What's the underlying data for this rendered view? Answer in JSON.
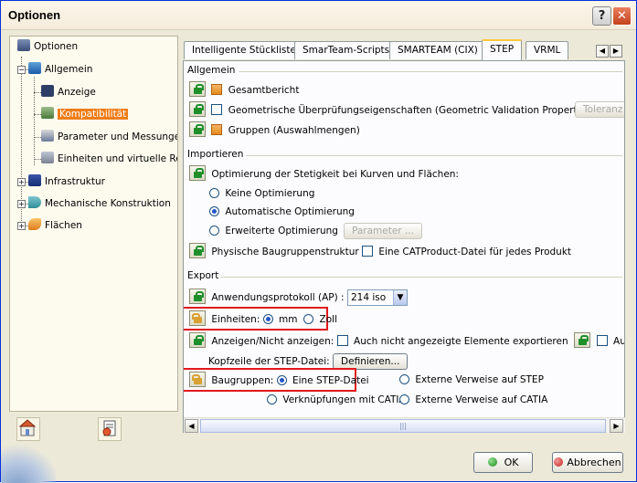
{
  "window": {
    "title": "Optionen",
    "help_glyph": "?",
    "close_glyph": "✕"
  },
  "tree": {
    "items": [
      {
        "label": "Optionen",
        "icon": "options-tree-icon"
      },
      {
        "label": "Allgemein",
        "icon": "general-icon"
      },
      {
        "label": "Anzeige",
        "icon": "display-icon"
      },
      {
        "label": "Kompatibilität",
        "icon": "compatibility-icon",
        "selected": true
      },
      {
        "label": "Parameter und Messungen",
        "icon": "parameters-icon"
      },
      {
        "label": "Einheiten und virtuelle Realit",
        "icon": "units-icon"
      },
      {
        "label": "Infrastruktur",
        "icon": "infrastructure-icon"
      },
      {
        "label": "Mechanische Konstruktion",
        "icon": "mechanical-design-icon"
      },
      {
        "label": "Flächen",
        "icon": "surfaces-icon"
      }
    ]
  },
  "tabs": [
    "Intelligente Stückliste",
    "SmarTeam-Scripts",
    "SMARTEAM (CIX)",
    "STEP",
    "VRML"
  ],
  "active_tab": "STEP",
  "sections": {
    "allgemein": {
      "title": "Allgemein",
      "gesamtbericht": "Gesamtbericht",
      "gvp": "Geometrische Überprüfungseigenschaften (Geometric Validation Properties, GVP)",
      "toleranz": "Toleranz",
      "gruppen": "Gruppen (Auswahlmengen)"
    },
    "importieren": {
      "title": "Importieren",
      "optimierung": "Optimierung der Stetigkeit bei Kurven und Flächen:",
      "keine": "Keine Optimierung",
      "automatisch": "Automatische Optimierung",
      "erweitert": "Erweiterte Optimierung",
      "parameter": "Parameter ...",
      "physische": "Physische Baugruppenstruktur",
      "catproduct": "Eine CATProduct-Datei für jedes Produkt"
    },
    "export": {
      "title": "Export",
      "ap_label": "Anwendungsprotokoll (AP) :",
      "ap_value": "214 iso",
      "einheiten_label": "Einheiten:",
      "mm": "mm",
      "zoll": "Zoll",
      "anzeigen_label": "Anzeigen/Nicht anzeigen:",
      "auch_nicht": "Auch nicht angezeigte Elemente exportieren",
      "auch_nicht_2": "Auch nicht d",
      "kopfzeile": "Kopfzeile der STEP-Datei:",
      "definieren": "Definieren...",
      "baugruppen_label": "Baugruppen:",
      "eine_step": "Eine STEP-Datei",
      "externe_step": "Externe Verweise auf STEP",
      "verknuepfungen": "Verknüpfungen mit CATIA",
      "externe_catia": "Externe Verweise auf CATIA"
    }
  },
  "scroll": {
    "left": "◀",
    "right": "▶",
    "grip": "|||",
    "tab_left": "◀",
    "tab_right": "▶"
  },
  "footer": {
    "ok": "OK",
    "cancel": "Abbrechen"
  },
  "colors": {
    "selection": "#ef7d18",
    "highlight": "#e0191b",
    "lock_green": "#1f8f2a"
  }
}
